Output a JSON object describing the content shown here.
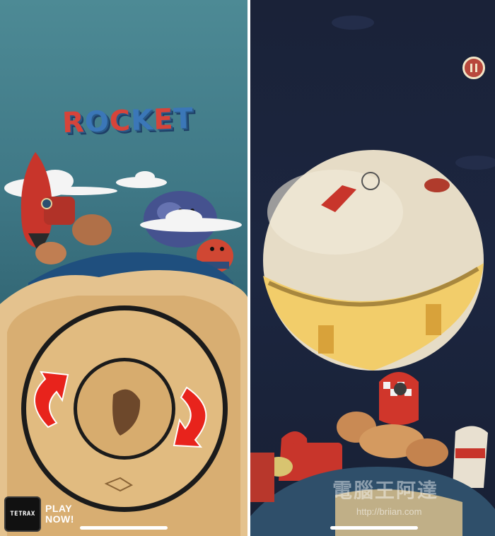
{
  "left_screen": {
    "title_letters": [
      "R",
      "O",
      "C",
      "K",
      "E",
      "T"
    ],
    "ad": {
      "logo_label": "TETRAX",
      "cta_line1": "PLAY",
      "cta_line2": "NOW!"
    }
  },
  "right_screen": {
    "pause_button_icon": "pause-icon",
    "watermark": "電腦王阿達",
    "watermark_url": "http://briian.com"
  },
  "colors": {
    "left_sky": "#3f7886",
    "right_sky": "#1c2640",
    "wood": "#d9b27a",
    "rocket_red": "#c8352b",
    "arrow_red": "#e8231c",
    "pause_button": "#b8483c"
  }
}
